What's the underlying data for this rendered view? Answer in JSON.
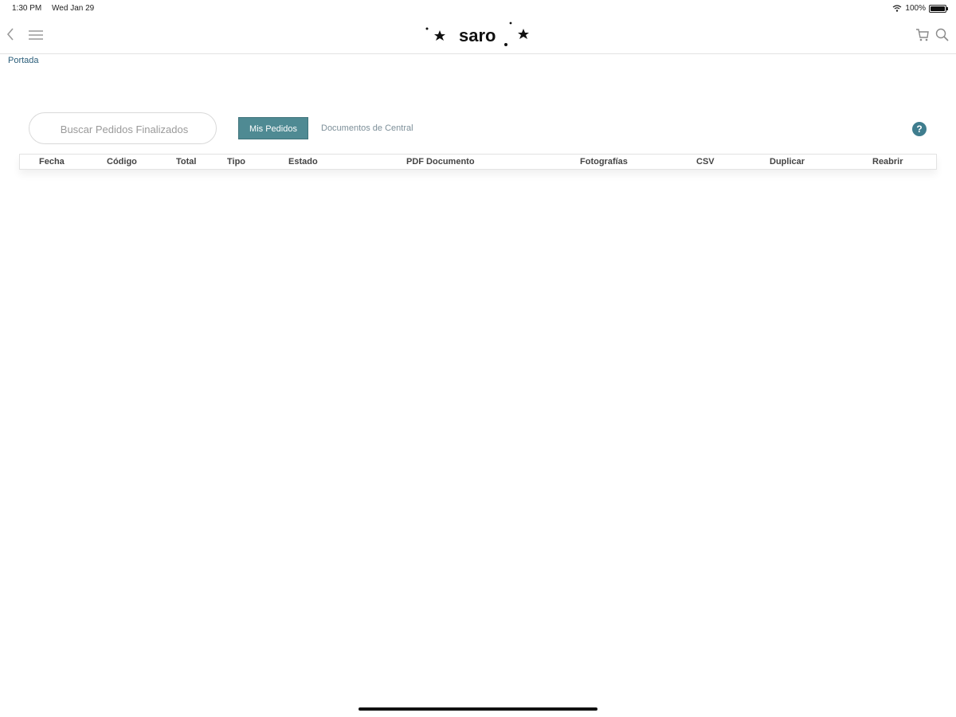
{
  "status_bar": {
    "time": "1:30 PM",
    "date": "Wed Jan 29",
    "battery": "100%"
  },
  "header": {
    "logo_text": "saro",
    "icons": [
      "back-icon",
      "menu-icon",
      "cart-icon",
      "search-icon"
    ]
  },
  "breadcrumb": {
    "label": "Portada"
  },
  "search": {
    "placeholder": "Buscar Pedidos Finalizados",
    "value": ""
  },
  "tabs": [
    {
      "label": "Mis Pedidos",
      "active": true
    },
    {
      "label": "Documentos de Central",
      "active": false
    }
  ],
  "help": {
    "label": "?"
  },
  "table": {
    "columns": [
      "Fecha",
      "Código",
      "Total",
      "Tipo",
      "Estado",
      "PDF Documento",
      "Fotografías",
      "CSV",
      "Duplicar",
      "Reabrir"
    ],
    "rows": []
  },
  "colors": {
    "accent": "#4f8a93",
    "help": "#3f7d8e",
    "link": "#2b5e7a"
  }
}
